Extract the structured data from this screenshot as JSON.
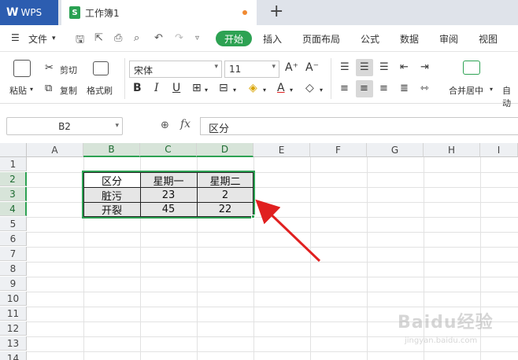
{
  "titlebar": {
    "app_name": "WPS",
    "doc_name": "工作簿1",
    "new_tab": "+"
  },
  "menubar": {
    "file": "文件",
    "active_tab": "开始",
    "tabs": [
      "插入",
      "页面布局",
      "公式",
      "数据",
      "审阅",
      "视图"
    ]
  },
  "ribbon": {
    "paste": "粘贴",
    "cut": "剪切",
    "copy": "复制",
    "format_painter": "格式刷",
    "font_name": "宋体",
    "font_size": "11",
    "merge_center": "合并居中",
    "auto": "自动"
  },
  "formula_bar": {
    "cell_ref": "B2",
    "fx": "fx",
    "content": "区分"
  },
  "sheet": {
    "columns": [
      "A",
      "B",
      "C",
      "D",
      "E",
      "F",
      "G",
      "H",
      "I"
    ],
    "rows": [
      "1",
      "2",
      "3",
      "4",
      "5",
      "6",
      "7",
      "8",
      "9",
      "10",
      "11",
      "12",
      "13",
      "14"
    ],
    "table": [
      [
        "区分",
        "星期一",
        "星期二"
      ],
      [
        "脏污",
        "23",
        "2"
      ],
      [
        "开裂",
        "45",
        "22"
      ]
    ]
  },
  "watermark": {
    "brand": "Baidu经验",
    "url": "jingyan.baidu.com"
  },
  "colors": {
    "accent_green": "#2da253",
    "wps_blue": "#2c5db0",
    "arrow_red": "#e02020"
  }
}
